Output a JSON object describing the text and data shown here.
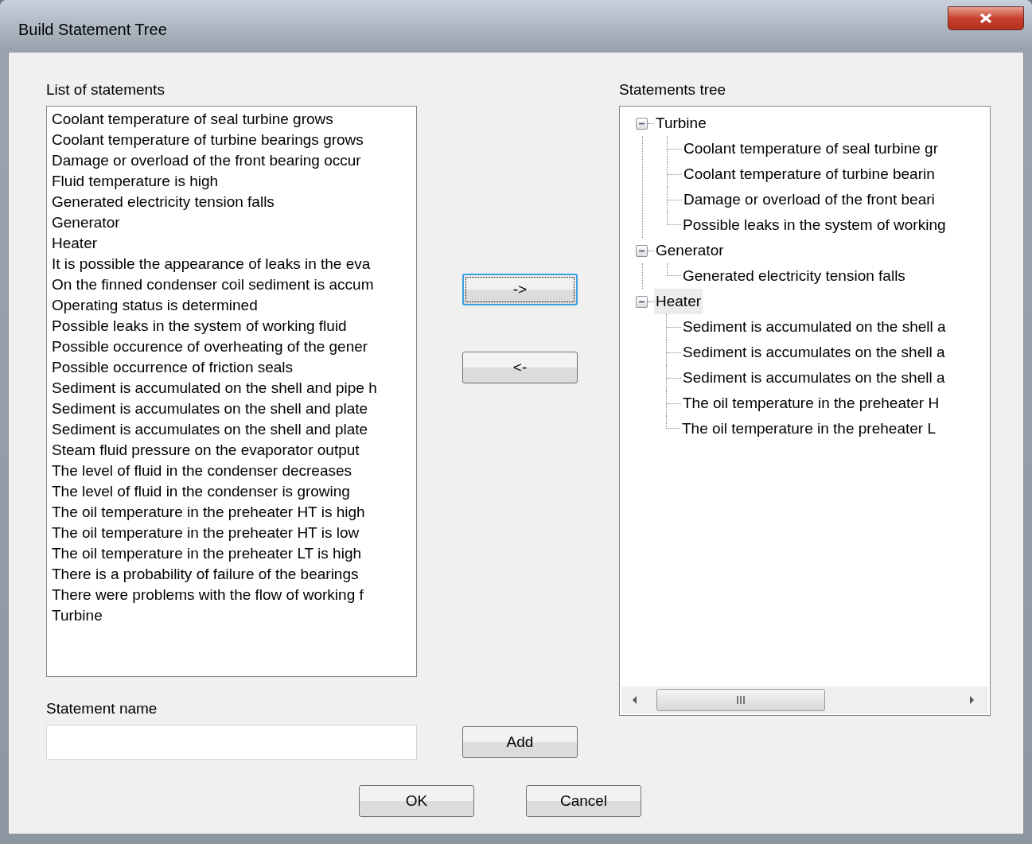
{
  "window": {
    "title": "Build Statement Tree"
  },
  "list_of_statements": {
    "label": "List of statements",
    "items": [
      {
        "text": "Coolant temperature of seal turbine grows"
      },
      {
        "text": "Coolant temperature of turbine bearings grows"
      },
      {
        "text": "Damage or overload of the front bearing occur"
      },
      {
        "text": "Fluid temperature is high"
      },
      {
        "text": "Generated electricity tension falls"
      },
      {
        "text": "Generator"
      },
      {
        "text": "Heater"
      },
      {
        "text": "It is possible the appearance of leaks in the eva"
      },
      {
        "text": "On the finned condenser coil sediment is accum"
      },
      {
        "text": "Operating status is determined"
      },
      {
        "text": "Possible leaks in the system of working fluid"
      },
      {
        "text": "Possible occurence of overheating of the gener"
      },
      {
        "text": "Possible occurrence of friction seals"
      },
      {
        "text": "Sediment is accumulated on the shell and pipe h"
      },
      {
        "text": "Sediment is accumulates on the shell and plate"
      },
      {
        "text": "Sediment is accumulates on the shell and plate"
      },
      {
        "text": "Steam fluid pressure on the evaporator output"
      },
      {
        "text": "The level of fluid in the condenser decreases"
      },
      {
        "text": "The level of fluid in the condenser is growing"
      },
      {
        "text": "The oil temperature in the preheater HT is high"
      },
      {
        "text": "The oil temperature in the preheater HT is low"
      },
      {
        "text": "The oil temperature in the preheater LT is high"
      },
      {
        "text": "There is a probability of failure of the bearings"
      },
      {
        "text": "There were problems with the flow of working f"
      },
      {
        "text": "Turbine"
      }
    ]
  },
  "move_buttons": [
    {
      "label": "->",
      "focused": true
    },
    {
      "label": "<-",
      "focused": false
    }
  ],
  "statement_name": {
    "label": "Statement name"
  },
  "add_button": "Add",
  "statements_tree": {
    "label": "Statements tree",
    "nodes": [
      {
        "text": "Turbine",
        "expanded": true,
        "selected": false,
        "children": [
          {
            "text": "Coolant temperature of seal turbine gr",
            "selected": false
          },
          {
            "text": "Coolant temperature of turbine bearin",
            "selected": false
          },
          {
            "text": "Damage or overload of the front beari",
            "selected": false
          },
          {
            "text": "Possible leaks in the system of working",
            "selected": false
          }
        ]
      },
      {
        "text": "Generator",
        "expanded": true,
        "selected": false,
        "children": [
          {
            "text": "Generated electricity tension falls",
            "selected": false
          }
        ]
      },
      {
        "text": "Heater",
        "expanded": true,
        "selected": true,
        "children": [
          {
            "text": "Sediment is accumulated on the shell a",
            "selected": false
          },
          {
            "text": "Sediment is accumulates on the shell a",
            "selected": false
          },
          {
            "text": "Sediment is accumulates on the shell a",
            "selected": false
          },
          {
            "text": "The oil temperature in the preheater H",
            "selected": false
          },
          {
            "text": "The oil temperature in the preheater L",
            "selected": false
          }
        ]
      }
    ]
  },
  "dialog_buttons": [
    "OK",
    "Cancel"
  ]
}
